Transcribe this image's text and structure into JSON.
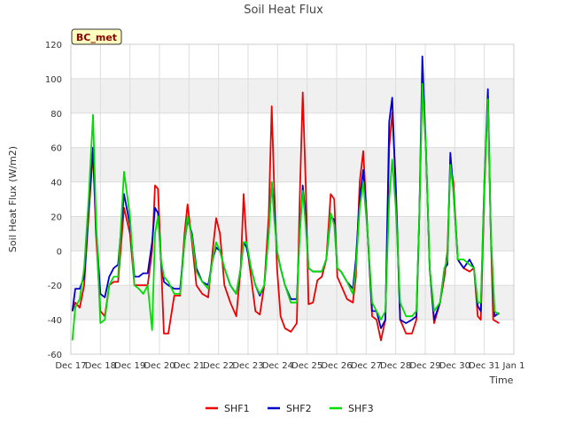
{
  "chart_data": {
    "type": "line",
    "title": "Soil Heat Flux",
    "xlabel": "Time",
    "ylabel": "Soil Heat Flux (W/m2)",
    "badge": "BC_met",
    "ylim": [
      -60,
      120
    ],
    "yticks": [
      -60,
      -40,
      -20,
      0,
      20,
      40,
      60,
      80,
      100,
      120
    ],
    "xlim": [
      17,
      32
    ],
    "xticks": [
      17,
      18,
      19,
      20,
      21,
      22,
      23,
      24,
      25,
      26,
      27,
      28,
      29,
      30,
      31,
      32
    ],
    "xtick_labels": [
      "Dec 17",
      "Dec 18",
      "Dec 19",
      "Dec 20",
      "Dec 21",
      "Dec 22",
      "Dec 23",
      "Dec 24",
      "Dec 25",
      "Dec 26",
      "Dec 27",
      "Dec 28",
      "Dec 29",
      "Dec 30",
      "Dec 31",
      "Jan 1"
    ],
    "grid": true,
    "band_color": "#f0f0f0",
    "legend_position": "bottom",
    "series": [
      {
        "name": "SHF1",
        "color": "#ee0000",
        "x": [
          17.05,
          17.15,
          17.3,
          17.45,
          17.6,
          17.75,
          17.85,
          18.0,
          18.15,
          18.3,
          18.45,
          18.6,
          18.8,
          19.0,
          19.15,
          19.3,
          19.45,
          19.6,
          19.75,
          19.85,
          19.95,
          20.05,
          20.15,
          20.3,
          20.5,
          20.7,
          20.85,
          20.95,
          21.1,
          21.25,
          21.45,
          21.65,
          21.8,
          21.92,
          22.05,
          22.2,
          22.4,
          22.6,
          22.75,
          22.85,
          22.95,
          23.1,
          23.25,
          23.4,
          23.55,
          23.7,
          23.8,
          23.88,
          23.98,
          24.1,
          24.25,
          24.45,
          24.65,
          24.75,
          24.85,
          24.95,
          25.05,
          25.2,
          25.35,
          25.5,
          25.65,
          25.8,
          25.92,
          26.02,
          26.15,
          26.35,
          26.55,
          26.65,
          26.78,
          26.9,
          27.05,
          27.2,
          27.35,
          27.5,
          27.65,
          27.78,
          27.88,
          28.0,
          28.15,
          28.35,
          28.55,
          28.7,
          28.8,
          28.9,
          29.02,
          29.15,
          29.3,
          29.5,
          29.65,
          29.75,
          29.85,
          29.95,
          30.1,
          30.3,
          30.5,
          30.65,
          30.78,
          30.88,
          31.0,
          31.12,
          31.22
        ],
        "values": [
          -35,
          -30,
          -33,
          -20,
          20,
          58,
          10,
          -35,
          -38,
          -20,
          -18,
          -18,
          25,
          10,
          -20,
          -20,
          -20,
          -20,
          0,
          38,
          36,
          -5,
          -48,
          -48,
          -26,
          -26,
          10,
          27,
          5,
          -20,
          -25,
          -27,
          0,
          19,
          10,
          -20,
          -30,
          -38,
          -10,
          33,
          5,
          -15,
          -35,
          -37,
          -20,
          20,
          84,
          40,
          -10,
          -38,
          -45,
          -47,
          -42,
          30,
          92,
          40,
          -31,
          -30,
          -17,
          -15,
          -5,
          33,
          30,
          -15,
          -20,
          -28,
          -30,
          -15,
          40,
          58,
          10,
          -38,
          -40,
          -52,
          -40,
          60,
          80,
          40,
          -40,
          -48,
          -48,
          -40,
          20,
          95,
          60,
          -10,
          -42,
          -30,
          -15,
          0,
          50,
          40,
          -5,
          -10,
          -12,
          -10,
          -38,
          -40,
          35,
          90,
          10
        ],
        "x2": [
          31.3,
          31.5
        ],
        "values2": [
          -40,
          -42
        ]
      },
      {
        "name": "SHF2",
        "color": "#0000cc",
        "x": [
          17.05,
          17.15,
          17.3,
          17.45,
          17.6,
          17.75,
          17.85,
          18.0,
          18.15,
          18.3,
          18.45,
          18.6,
          18.8,
          19.0,
          19.15,
          19.3,
          19.45,
          19.6,
          19.75,
          19.85,
          19.95,
          20.05,
          20.15,
          20.3,
          20.5,
          20.7,
          20.85,
          20.95,
          21.1,
          21.25,
          21.45,
          21.65,
          21.8,
          21.92,
          22.05,
          22.2,
          22.4,
          22.6,
          22.75,
          22.85,
          22.95,
          23.1,
          23.25,
          23.4,
          23.55,
          23.7,
          23.8,
          23.88,
          23.98,
          24.1,
          24.25,
          24.45,
          24.65,
          24.75,
          24.85,
          24.95,
          25.05,
          25.2,
          25.35,
          25.5,
          25.65,
          25.8,
          25.92,
          26.02,
          26.15,
          26.35,
          26.55,
          26.65,
          26.78,
          26.9,
          27.05,
          27.2,
          27.35,
          27.5,
          27.65,
          27.78,
          27.88,
          28.0,
          28.15,
          28.35,
          28.55,
          28.7,
          28.8,
          28.9,
          29.02,
          29.15,
          29.3,
          29.5,
          29.65,
          29.75,
          29.85,
          29.95,
          30.1,
          30.3,
          30.5,
          30.65,
          30.78,
          30.88,
          31.0,
          31.12,
          31.22,
          31.35,
          31.5
        ],
        "values": [
          -35,
          -22,
          -22,
          -15,
          25,
          60,
          15,
          -25,
          -27,
          -15,
          -10,
          -8,
          33,
          15,
          -15,
          -15,
          -13,
          -13,
          5,
          25,
          22,
          -5,
          -18,
          -20,
          -22,
          -22,
          5,
          18,
          10,
          -10,
          -18,
          -20,
          -5,
          2,
          0,
          -10,
          -20,
          -25,
          -10,
          5,
          2,
          -10,
          -20,
          -26,
          -20,
          10,
          40,
          25,
          0,
          -10,
          -20,
          -28,
          -28,
          10,
          38,
          20,
          -10,
          -12,
          -12,
          -12,
          -5,
          20,
          18,
          -10,
          -12,
          -18,
          -22,
          -5,
          30,
          47,
          10,
          -35,
          -35,
          -45,
          -40,
          75,
          89,
          35,
          -40,
          -42,
          -40,
          -38,
          20,
          113,
          60,
          -10,
          -40,
          -30,
          -10,
          -8,
          57,
          35,
          -5,
          -10,
          -5,
          -10,
          -32,
          -35,
          40,
          94,
          10,
          -38,
          -36
        ]
      },
      {
        "name": "SHF3",
        "color": "#00dd00",
        "x": [
          17.05,
          17.15,
          17.3,
          17.45,
          17.6,
          17.75,
          17.85,
          18.0,
          18.15,
          18.3,
          18.45,
          18.6,
          18.8,
          19.0,
          19.15,
          19.3,
          19.45,
          19.6,
          19.75,
          19.85,
          19.95,
          20.05,
          20.15,
          20.3,
          20.5,
          20.7,
          20.85,
          20.95,
          21.1,
          21.25,
          21.45,
          21.65,
          21.8,
          21.92,
          22.05,
          22.2,
          22.4,
          22.6,
          22.75,
          22.85,
          22.95,
          23.1,
          23.25,
          23.4,
          23.55,
          23.7,
          23.8,
          23.88,
          23.98,
          24.1,
          24.25,
          24.45,
          24.65,
          24.75,
          24.85,
          24.95,
          25.05,
          25.2,
          25.35,
          25.5,
          25.65,
          25.8,
          25.92,
          26.02,
          26.15,
          26.35,
          26.55,
          26.65,
          26.78,
          26.9,
          27.05,
          27.2,
          27.35,
          27.5,
          27.65,
          27.78,
          27.88,
          28.0,
          28.15,
          28.35,
          28.55,
          28.7,
          28.8,
          28.9,
          29.02,
          29.15,
          29.3,
          29.5,
          29.65,
          29.75,
          29.85,
          29.95,
          30.1,
          30.3,
          30.5,
          30.65,
          30.78,
          30.88,
          31.0,
          31.12,
          31.22,
          31.35,
          31.5
        ],
        "values": [
          -52,
          -33,
          -28,
          -10,
          30,
          79,
          20,
          -42,
          -40,
          -20,
          -15,
          -15,
          46,
          20,
          -20,
          -22,
          -25,
          -20,
          -46,
          10,
          20,
          -5,
          -15,
          -18,
          -25,
          -25,
          5,
          20,
          8,
          -12,
          -18,
          -22,
          -5,
          5,
          0,
          -10,
          -20,
          -25,
          -10,
          5,
          5,
          -10,
          -20,
          -25,
          -20,
          10,
          40,
          20,
          0,
          -10,
          -20,
          -30,
          -30,
          10,
          35,
          15,
          -10,
          -12,
          -12,
          -12,
          -5,
          22,
          15,
          -10,
          -12,
          -18,
          -25,
          -10,
          25,
          40,
          10,
          -30,
          -35,
          -40,
          -35,
          30,
          53,
          25,
          -30,
          -38,
          -38,
          -35,
          20,
          97,
          60,
          -10,
          -35,
          -30,
          -10,
          -5,
          50,
          35,
          -5,
          -5,
          -8,
          -10,
          -30,
          -30,
          40,
          88,
          10,
          -35,
          -37
        ]
      }
    ]
  }
}
